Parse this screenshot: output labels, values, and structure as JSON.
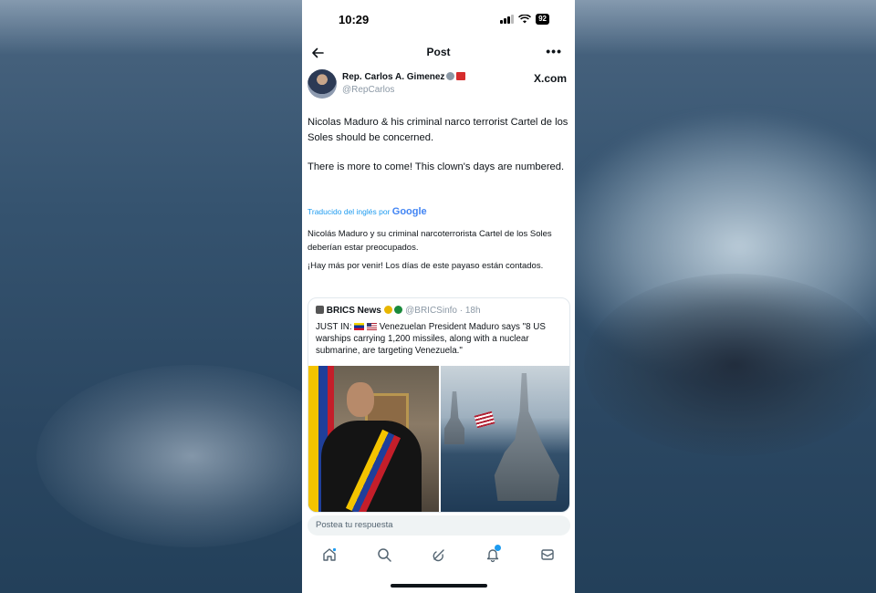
{
  "status": {
    "time": "10:29",
    "battery": "92"
  },
  "nav": {
    "title": "Post"
  },
  "author": {
    "name": "Rep. Carlos A. Gimenez",
    "handle": "@RepCarlos",
    "source_badge": "X.com"
  },
  "tweet": {
    "paragraphs": [
      "Nicolas Maduro & his criminal narco terrorist Cartel de los Soles should be concerned.",
      "There is more to come! This clown's days are numbered."
    ]
  },
  "translation": {
    "label": "Traducido del inglés por",
    "provider": "Google",
    "paragraphs": [
      "Nicolás Maduro y su criminal narcoterrorista Cartel de los Soles deberían estar preocupados.",
      "¡Hay más por venir! Los días de este payaso están contados."
    ]
  },
  "quote": {
    "name": "BRICS News",
    "handle": "@BRICSinfo",
    "time": "18h",
    "prefix": "JUST IN:",
    "text": "Venezuelan President Maduro says \"8 US warships carrying 1,200 missiles, along with a nuclear submarine, are targeting Venezuela.\""
  },
  "reply": {
    "placeholder": "Postea tu respuesta"
  },
  "tabbar": {
    "items": [
      "home-icon",
      "search-icon",
      "grok-icon",
      "notifications-icon",
      "messages-icon"
    ]
  },
  "colors": {
    "accent": "#1d9bf0",
    "text": "#0f1419",
    "muted": "#8b98a5"
  }
}
